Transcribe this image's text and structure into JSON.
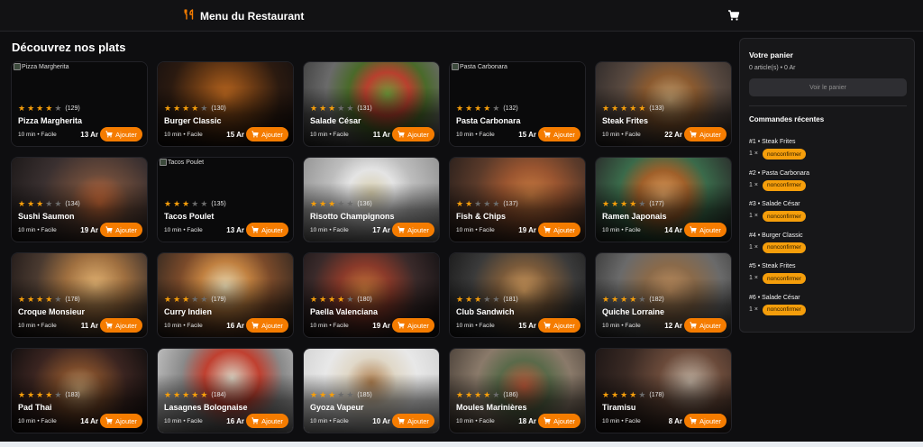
{
  "header": {
    "title": "Menu du Restaurant",
    "logo_icon": "fork-knife-icon",
    "cart_icon": "shopping-cart-icon",
    "accent": "#f57c00"
  },
  "main": {
    "heading": "Découvrez nos plats",
    "add_label": "Ajouter"
  },
  "dishes": [
    {
      "name": "Pizza Margherita",
      "rating": 4,
      "reviews": "(129)",
      "meta": "10 min • Facile",
      "price": "13 Ar",
      "alt": "Pizza Margherita",
      "broken": true,
      "bg": "#0a0a0b"
    },
    {
      "name": "Burger Classic",
      "rating": 4,
      "reviews": "(130)",
      "meta": "10 min • Facile",
      "price": "15 Ar",
      "alt": "",
      "broken": false,
      "bg": "radial-gradient(circle at 50% 40%, #b8651e 0%, #6a3a14 35%, #2b1a10 65%, #151010 100%)"
    },
    {
      "name": "Salade César",
      "rating": 3,
      "reviews": "(131)",
      "meta": "10 min • Facile",
      "price": "11 Ar",
      "alt": "",
      "broken": false,
      "bg": "radial-gradient(circle at 62% 38%, #6f9a3a 0%, #b8402e 22%, #4a6a2a 40%, #6a6a6a 62%, #3a3a3a 100%)"
    },
    {
      "name": "Pasta Carbonara",
      "rating": 4,
      "reviews": "(132)",
      "meta": "10 min • Facile",
      "price": "15 Ar",
      "alt": "Pasta Carbonara",
      "broken": true,
      "bg": "#0a0a0b"
    },
    {
      "name": "Steak Frites",
      "rating": 5,
      "reviews": "(133)",
      "meta": "10 min • Facile",
      "price": "22 Ar",
      "alt": "",
      "broken": false,
      "bg": "radial-gradient(circle at 55% 45%, #c4a070 0%, #8a5a30 30%, #5a4a40 55%, #2e2a2a 100%)"
    },
    {
      "name": "Sushi Saumon",
      "rating": 3,
      "reviews": "(134)",
      "meta": "10 min • Facile",
      "price": "19 Ar",
      "alt": "",
      "broken": false,
      "bg": "radial-gradient(circle at 65% 55%, #d8703a 0%, #6a4a3a 30%, #3a3030 60%, #1e1a1a 100%)"
    },
    {
      "name": "Tacos Poulet",
      "rating": 3,
      "reviews": "(135)",
      "meta": "10 min • Facile",
      "price": "13 Ar",
      "alt": "Tacos Poulet",
      "broken": true,
      "bg": "#0a0a0b"
    },
    {
      "name": "Risotto Champignons",
      "rating": 3,
      "reviews": "(136)",
      "meta": "10 min • Facile",
      "price": "17 Ar",
      "alt": "",
      "broken": false,
      "bg": "radial-gradient(circle at 50% 42%, #d8cfae 0%, #e4e4e4 28%, #bdbdbd 50%, #8e8e8e 100%)"
    },
    {
      "name": "Fish & Chips",
      "rating": 2,
      "reviews": "(137)",
      "meta": "10 min • Facile",
      "price": "19 Ar",
      "alt": "",
      "broken": false,
      "bg": "radial-gradient(circle at 60% 45%, #c77a40 0%, #9a5530 30%, #5a3a2a 60%, #2a201c 100%)"
    },
    {
      "name": "Ramen Japonais",
      "rating": 4,
      "reviews": "(177)",
      "meta": "10 min • Facile",
      "price": "14 Ar",
      "alt": "",
      "broken": false,
      "bg": "radial-gradient(circle at 50% 45%, #e0a060 0%, #a0602a 30%, #3a6a4a 55%, #2a2a2a 100%)"
    },
    {
      "name": "Croque Monsieur",
      "rating": 4,
      "reviews": "(178)",
      "meta": "10 min • Facile",
      "price": "11 Ar",
      "alt": "",
      "broken": false,
      "bg": "radial-gradient(circle at 62% 38%, #e0b070 0%, #a07040 30%, #4a3a30 60%, #1c1616 100%)"
    },
    {
      "name": "Curry Indien",
      "rating": 3,
      "reviews": "(179)",
      "meta": "10 min • Facile",
      "price": "16 Ar",
      "alt": "",
      "broken": false,
      "bg": "radial-gradient(circle at 50% 40%, #e8d8b0 0%, #c08040 30%, #7a4a2a 55%, #2a2420 100%)"
    },
    {
      "name": "Paella Valenciana",
      "rating": 4,
      "reviews": "(180)",
      "meta": "10 min • Facile",
      "price": "19 Ar",
      "alt": "",
      "broken": false,
      "bg": "radial-gradient(circle at 45% 45%, #c8783a 0%, #8a3a2a 30%, #3a2a2a 60%, #141214 100%)"
    },
    {
      "name": "Club Sandwich",
      "rating": 3,
      "reviews": "(181)",
      "meta": "10 min • Facile",
      "price": "15 Ar",
      "alt": "",
      "broken": false,
      "bg": "radial-gradient(circle at 55% 45%, #d8a060 0%, #7a5a3a 30%, #3a3a3a 60%, #1a1a1a 100%)"
    },
    {
      "name": "Quiche Lorraine",
      "rating": 4,
      "reviews": "(182)",
      "meta": "10 min • Facile",
      "price": "12 Ar",
      "alt": "",
      "broken": false,
      "bg": "radial-gradient(circle at 55% 45%, #c09060 0%, #8a6a4a 30%, #6a6a6a 60%, #3a3a3a 100%)"
    },
    {
      "name": "Pad Thai",
      "rating": 4,
      "reviews": "(183)",
      "meta": "10 min • Facile",
      "price": "14 Ar",
      "alt": "",
      "broken": false,
      "bg": "radial-gradient(circle at 50% 50%, #c8a070 0%, #7a4a2a 30%, #3a2420 60%, #141010 100%)"
    },
    {
      "name": "Lasagnes Bolognaise",
      "rating": 5,
      "reviews": "(184)",
      "meta": "10 min • Facile",
      "price": "16 Ar",
      "alt": "",
      "broken": false,
      "bg": "radial-gradient(circle at 55% 35%, #d8d0c0 0%, #c04030 30%, #8a8a8a 55%, #d0d0d0 100%)"
    },
    {
      "name": "Gyoza Vapeur",
      "rating": 3,
      "reviews": "(185)",
      "meta": "10 min • Facile",
      "price": "10 Ar",
      "alt": "",
      "broken": false,
      "bg": "radial-gradient(circle at 50% 40%, #b08050 0%, #e0d8c8 30%, #e8e8e8 55%, #cfcfcf 100%)"
    },
    {
      "name": "Moules Marinières",
      "rating": 4,
      "reviews": "(186)",
      "meta": "10 min • Facile",
      "price": "18 Ar",
      "alt": "",
      "broken": false,
      "bg": "radial-gradient(circle at 55% 45%, #c05a3a 0%, #5a6a4a 30%, #8a7a6a 55%, #4a4038 100%)"
    },
    {
      "name": "Tiramisu",
      "rating": 4,
      "reviews": "(178)",
      "meta": "10 min • Facile",
      "price": "8 Ar",
      "alt": "",
      "broken": false,
      "bg": "radial-gradient(circle at 70% 40%, #c0b0a0 0%, #6a4a3a 30%, #3a2a24 60%, #1a1414 100%)"
    }
  ],
  "cart": {
    "title": "Votre panier",
    "summary": "0 article(s) • 0 Ar",
    "button": "Voir le panier",
    "orders_title": "Commandes récentes",
    "orders": [
      {
        "label": "#1 • Steak Frites",
        "qty": "1 ×",
        "status": "nonconfirmer"
      },
      {
        "label": "#2 • Pasta Carbonara",
        "qty": "1 ×",
        "status": "nonconfirmer"
      },
      {
        "label": "#3 • Salade César",
        "qty": "1 ×",
        "status": "nonconfirmer"
      },
      {
        "label": "#4 • Burger Classic",
        "qty": "1 ×",
        "status": "nonconfirmer"
      },
      {
        "label": "#5 • Steak Frites",
        "qty": "1 ×",
        "status": "nonconfirmer"
      },
      {
        "label": "#6 • Salade César",
        "qty": "1 ×",
        "status": "nonconfirmer"
      }
    ]
  }
}
